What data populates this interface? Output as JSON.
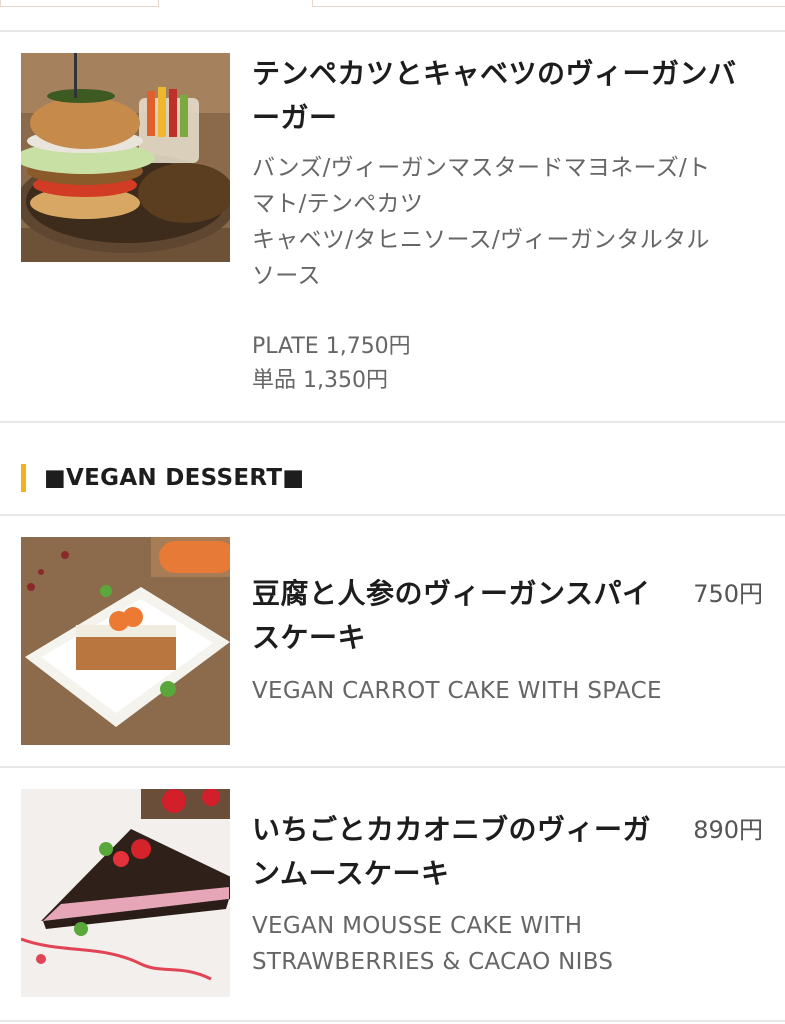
{
  "menu": {
    "items": [
      {
        "name": "テンペカツとキャベツのヴィーガンバーガー",
        "name_lines": [
          "テンペカツとキャベツのヴィーガンバ",
          "ーガー"
        ],
        "description": "バンズ/ヴィーガンマスタードマヨネーズ/ト\nマト/テンペカツ\nキャベツ/タヒニソース/ヴィーガンタルタル\nソース",
        "price_plate": "PLATE 1,750円",
        "price_single": "単品 1,350円",
        "photo_icon": "vegan-burger-photo"
      }
    ],
    "section": {
      "title": "■VEGAN DESSERT■"
    },
    "desserts": [
      {
        "name_lines": [
          "豆腐と人参のヴィーガンスパイ",
          "スケーキ"
        ],
        "price": "750円",
        "description": "VEGAN CARROT CAKE WITH SPACE",
        "photo_icon": "carrot-cake-photo"
      },
      {
        "name_lines": [
          "いちごとカカオニブのヴィーガ",
          "ンムースケーキ"
        ],
        "price": "890円",
        "description": "VEGAN MOUSSE CAKE WITH\nSTRAWBERRIES & CACAO NIBS",
        "photo_icon": "mousse-cake-photo"
      }
    ]
  }
}
